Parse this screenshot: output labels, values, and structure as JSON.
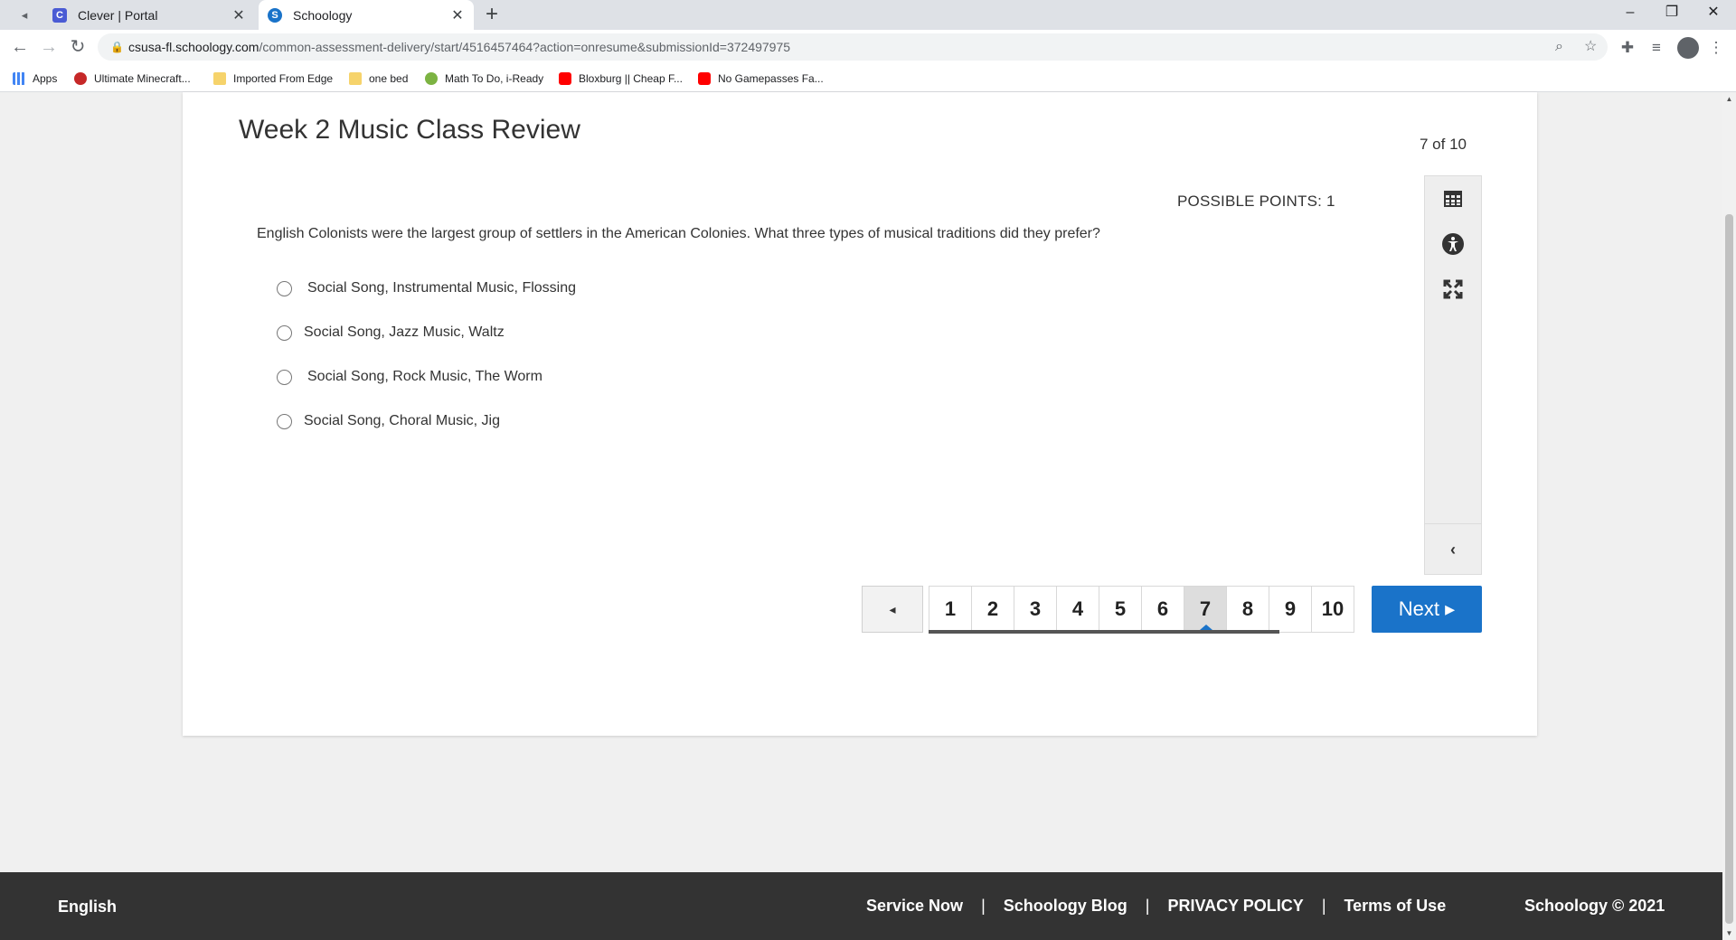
{
  "browser": {
    "tabs": [
      {
        "title": "Clever | Portal",
        "favicon": "clever-c-icon",
        "favicon_color": "#4a5bd4",
        "active": false
      },
      {
        "title": "Schoology",
        "favicon": "schoology-s-icon",
        "favicon_color": "#1a73c9",
        "active": true
      }
    ],
    "url_host": "csusa-fl.schoology.com",
    "url_path": "/common-assessment-delivery/start/4516457464?action=onresume&submissionId=372497975",
    "bookmarks": [
      {
        "label": "Apps",
        "icon": "apps-grid-icon",
        "color": "#4285f4"
      },
      {
        "label": "Ultimate Minecraft...",
        "icon": "minecraft-icon",
        "color": "#c62828"
      },
      {
        "label": "Imported From Edge",
        "icon": "folder-icon",
        "color": "#f6d36b"
      },
      {
        "label": "one bed",
        "icon": "folder-icon",
        "color": "#f6d36b"
      },
      {
        "label": "Math To Do, i-Ready",
        "icon": "iready-icon",
        "color": "#7cb342"
      },
      {
        "label": "Bloxburg || Cheap F...",
        "icon": "youtube-icon",
        "color": "#ff0000"
      },
      {
        "label": "No Gamepasses Fa...",
        "icon": "youtube-icon",
        "color": "#ff0000"
      }
    ]
  },
  "assessment": {
    "title": "Week 2 Music Class Review",
    "counter": "7 of 10",
    "possible_points": "POSSIBLE POINTS: 1",
    "question": "English Colonists were the largest group of settlers in the American Colonies. What three types of musical traditions did they prefer?",
    "options": [
      "Social Song, Instrumental Music, Flossing",
      "Social Song, Jazz Music, Waltz",
      "Social Song, Rock Music, The Worm",
      "Social Song, Choral Music, Jig"
    ],
    "tools": [
      "calculator-icon",
      "accessibility-icon",
      "fullscreen-icon"
    ],
    "pages": [
      "1",
      "2",
      "3",
      "4",
      "5",
      "6",
      "7",
      "8",
      "9",
      "10"
    ],
    "current_page": "7",
    "prev_label": "◂",
    "next_label": "Next ▸"
  },
  "footer": {
    "language": "English",
    "links": [
      "Service Now",
      "Schoology Blog",
      "PRIVACY POLICY",
      "Terms of Use"
    ],
    "separator": "|",
    "copyright": "Schoology © 2021"
  }
}
